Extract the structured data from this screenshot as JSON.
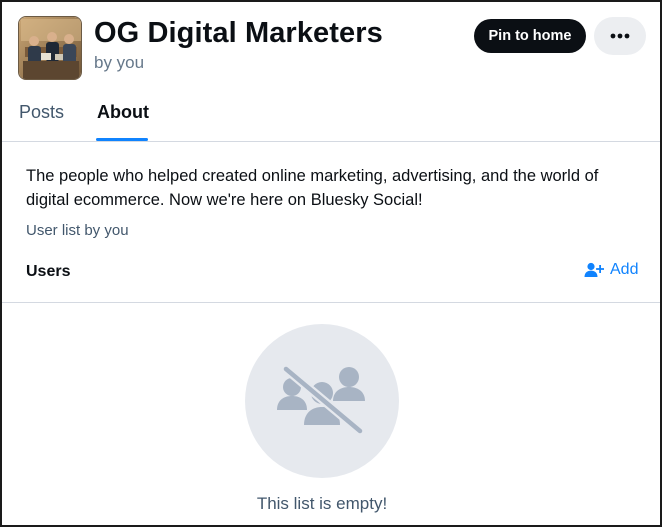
{
  "header": {
    "title": "OG Digital Marketers",
    "byline": "by you",
    "pin_label": "Pin to home",
    "more_icon": "more-options-icon"
  },
  "tabs": [
    {
      "label": "Posts",
      "active": false
    },
    {
      "label": "About",
      "active": true
    }
  ],
  "about": {
    "description": "The people who helped created online marketing, advertising, and the world of digital ecommerce. Now we're here on Bluesky Social!",
    "list_meta": "User list by you",
    "users_label": "Users",
    "add_label": "Add",
    "add_icon": "add-user-icon"
  },
  "empty_state": {
    "icon": "no-users-icon",
    "message": "This list is empty!"
  },
  "colors": {
    "accent": "#1083fe",
    "primary_text": "#0b0f14",
    "secondary_text": "#42576c",
    "icon_gray": "#a8b4c4",
    "empty_bg": "#e6e9ee"
  }
}
